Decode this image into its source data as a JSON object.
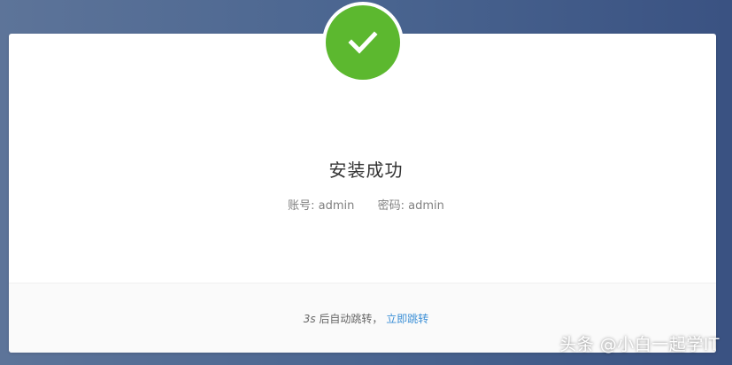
{
  "success": {
    "icon": "check-icon",
    "color": "#5cb82f",
    "title": "安装成功"
  },
  "credentials": {
    "account_label": "账号:",
    "account_value": "admin",
    "password_label": "密码:",
    "password_value": "admin"
  },
  "redirect": {
    "seconds": "3s",
    "text": "后自动跳转，",
    "link_label": "立即跳转",
    "link_color": "#3b8fd6"
  },
  "watermark": "头条 @小白一起学IT"
}
